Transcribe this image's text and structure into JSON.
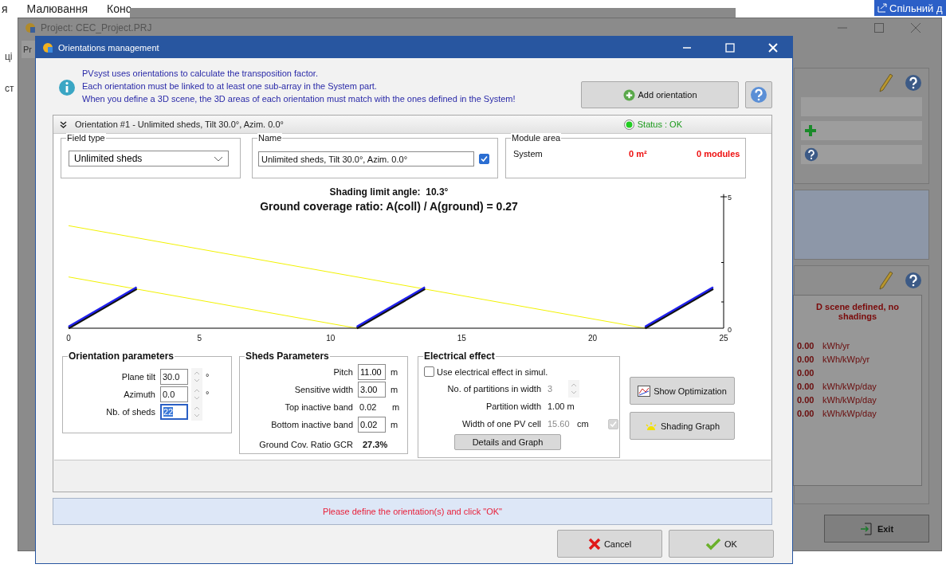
{
  "background_document": {
    "menu": [
      "я",
      "Малювання",
      "Конс"
    ],
    "share_button": "Спільний д",
    "margin_texts": [
      "ці",
      "ст"
    ]
  },
  "project_window": {
    "title": "Project: CEC_Project.PRJ",
    "tab": "Pr",
    "results_heading": "D scene defined, no shadings",
    "results": [
      {
        "value": "0.00",
        "unit": "kWh/yr"
      },
      {
        "value": "0.00",
        "unit": "kWh/kWp/yr"
      },
      {
        "value": "0.00"
      },
      {
        "value": "0.00",
        "unit": "kWh/kWp/day"
      },
      {
        "value": "0.00",
        "unit": "kWh/kWp/day"
      },
      {
        "value": "0.00",
        "unit": "kWh/kWp/day"
      }
    ],
    "exit_button": "Exit"
  },
  "dialog": {
    "title": "Orientations management",
    "info_lines": [
      "PVsyst uses orientations to calculate the transposition factor.",
      "Each orientation must be linked to at least one sub-array in the System part.",
      "When you define a 3D scene, the 3D areas of each orientation must match with the ones defined in the System!"
    ],
    "add_button": "Add orientation",
    "orientation": {
      "header": "Orientation #1 - Unlimited sheds, Tilt 30.0°, Azim. 0.0°",
      "status": "Status : OK",
      "status_ok": true,
      "field_type": {
        "label": "Field type",
        "value": "Unlimited sheds"
      },
      "name": {
        "label": "Name",
        "value": "Unlimited sheds, Tilt 30.0°, Azim. 0.0°",
        "checked": true
      },
      "module_area": {
        "label": "Module area",
        "row_label": "System",
        "area": "0 m²",
        "modules": "0 modules"
      },
      "diagram": {
        "shading_limit": "Shading limit angle:  10.3°",
        "gcr_title": "Ground coverage ratio: A(coll) / A(ground) = 0.27",
        "x_ticks": [
          "0",
          "5",
          "10",
          "15",
          "20",
          "25"
        ],
        "y_ticks": [
          "5",
          "0"
        ]
      },
      "orientation_parameters": {
        "title": "Orientation parameters",
        "rows": [
          {
            "label": "Plane tilt",
            "value": "30.0",
            "unit": "°",
            "focused": false
          },
          {
            "label": "Azimuth",
            "value": "0.0",
            "unit": "°",
            "focused": false
          },
          {
            "label": "Nb. of sheds",
            "value": "22",
            "focused": true
          }
        ]
      },
      "sheds_parameters": {
        "title": "Sheds Parameters",
        "rows": [
          {
            "kind": "input",
            "label": "Pitch",
            "value": "11.00",
            "unit": "m"
          },
          {
            "kind": "input",
            "label": "Sensitive width",
            "value": "3.00",
            "unit": "m"
          },
          {
            "kind": "readonly",
            "label": "Top inactive band",
            "value": "0.02",
            "unit": "m"
          },
          {
            "kind": "input",
            "label": "Bottom inactive band",
            "value": "0.02",
            "unit": "m"
          }
        ],
        "gcr_label": "Ground Cov. Ratio GCR",
        "gcr_value": "27.3%"
      },
      "electrical_effect": {
        "title": "Electrical effect",
        "use_label": "Use electrical effect in simul.",
        "use_checked": false,
        "disabled": true,
        "partitions_label": "No. of partitions in width",
        "partitions_value": "3",
        "partition_width_label": "Partition width",
        "partition_width_value": "1.00 m",
        "cell_width_label": "Width of one PV cell",
        "cell_width_value": "15.60",
        "cell_width_unit": "cm",
        "cell_checked": true,
        "details_button": "Details and Graph"
      },
      "show_optimization_button": "Show Optimization",
      "shading_graph_button": "Shading Graph"
    },
    "message": "Please define the orientation(s) and click \"OK\"",
    "cancel_button": "Cancel",
    "ok_button": "OK"
  }
}
